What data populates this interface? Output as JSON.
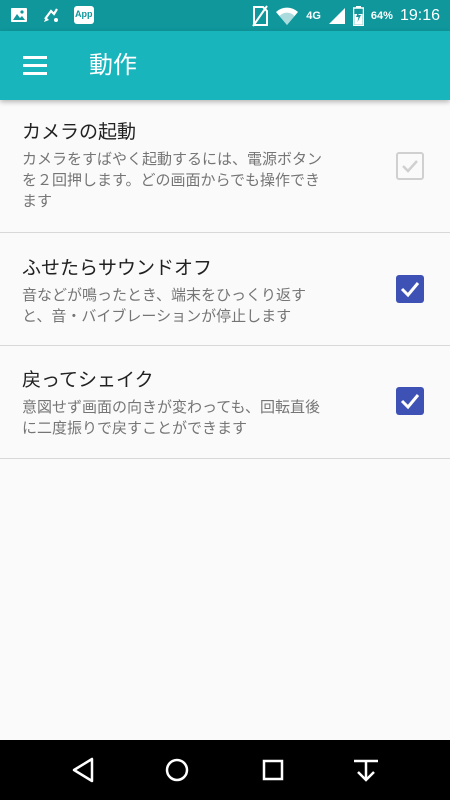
{
  "status_bar": {
    "left_icons": [
      "image-icon",
      "sync-icon",
      "app-icon"
    ],
    "app_icon_label": "App",
    "network": "4G",
    "battery": "64%",
    "time": "19:16"
  },
  "app_bar": {
    "title": "動作",
    "menu_icon": "hamburger-menu-icon"
  },
  "settings": [
    {
      "title": "カメラの起動",
      "summary_lines": [
        "カメラをすばやく起動するには、電源ボタン",
        "を２回押します。どの画面からでも操作でき",
        "ます"
      ],
      "checked": true,
      "enabled": false
    },
    {
      "title": "ふせたらサウンドオフ",
      "summary_lines": [
        "音などが鳴ったとき、端末をひっくり返す",
        "と、音・バイブレーションが停止します"
      ],
      "checked": true,
      "enabled": true
    },
    {
      "title": "戻ってシェイク",
      "summary_lines": [
        "意図せず画面の向きが変わっても、回転直後",
        "に二度振りで戻すことができます"
      ],
      "checked": true,
      "enabled": true
    }
  ],
  "nav_bar": {
    "buttons": [
      "back-icon",
      "home-icon",
      "recents-icon",
      "notification-pull-icon"
    ]
  },
  "colors": {
    "status_bar": "#0f979c",
    "app_bar": "#19b5bd",
    "checkbox": "#3e51b5",
    "background": "#fafafa"
  }
}
